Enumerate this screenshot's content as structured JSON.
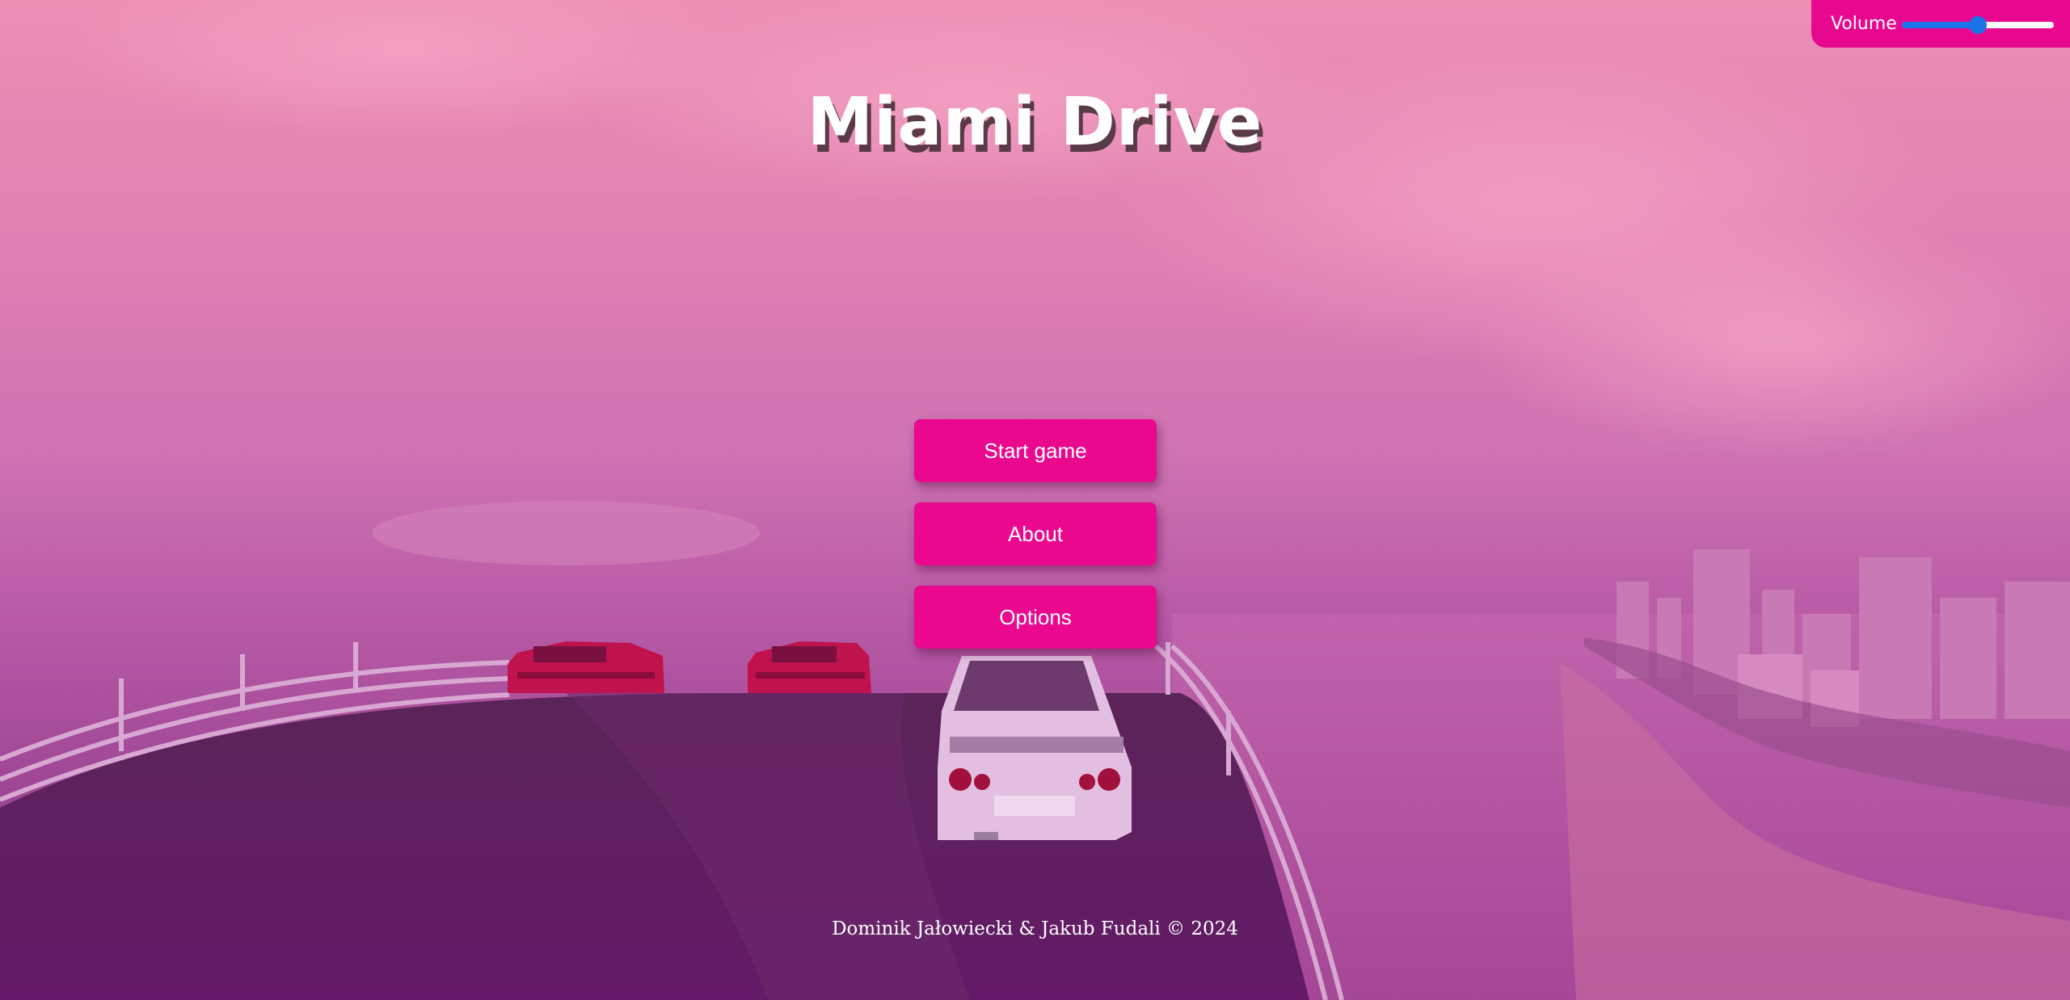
{
  "game": {
    "title": "Miami Drive",
    "footer": "Dominik Jałowiecki & Jakub Fudali © 2024"
  },
  "volume": {
    "label": "Volume",
    "level_fraction": 0.5
  },
  "menu": {
    "buttons": [
      {
        "id": "start",
        "label": "Start game"
      },
      {
        "id": "about",
        "label": "About"
      },
      {
        "id": "options",
        "label": "Options"
      }
    ]
  },
  "colors": {
    "accent": "#e9088e",
    "slider": "#1a73e8",
    "title_shadow": "#5b3a47"
  }
}
